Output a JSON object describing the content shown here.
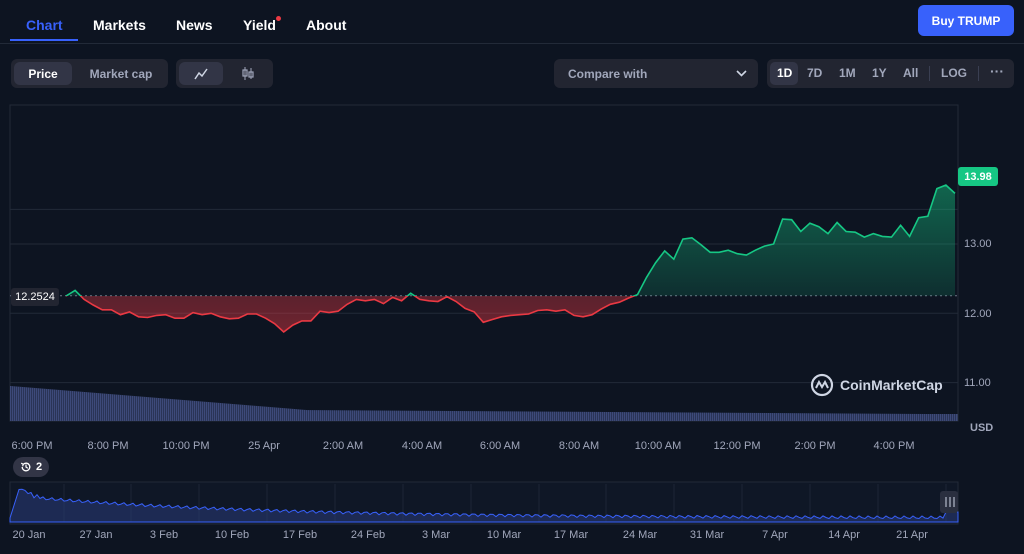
{
  "nav": {
    "tabs": [
      {
        "label": "Chart",
        "active": true
      },
      {
        "label": "Markets",
        "active": false
      },
      {
        "label": "News",
        "active": false
      },
      {
        "label": "Yield",
        "active": false,
        "badge": "red-dot"
      },
      {
        "label": "About",
        "active": false
      }
    ],
    "buy_label": "Buy TRUMP"
  },
  "toolbar": {
    "metric": [
      "Price",
      "Market cap"
    ],
    "metric_selected": "Price",
    "chart_type_icons": [
      "line-chart-icon",
      "candlestick-icon"
    ],
    "compare_placeholder": "Compare with",
    "ranges": [
      "1D",
      "7D",
      "1M",
      "1Y",
      "All",
      "LOG"
    ],
    "range_selected": "1D",
    "more_icon": "more-icon"
  },
  "chart_data": {
    "type": "line",
    "currency": "USD",
    "current_price": "13.98",
    "open_price": "12.2524",
    "y_ticks": [
      "13.00",
      "12.00",
      "11.00"
    ],
    "ylim": [
      10.9,
      14.0
    ],
    "x_ticks": [
      "6:00 PM",
      "8:00 PM",
      "10:00 PM",
      "25 Apr",
      "2:00 AM",
      "4:00 AM",
      "6:00 AM",
      "8:00 AM",
      "10:00 AM",
      "12:00 PM",
      "2:00 PM",
      "4:00 PM"
    ],
    "series": [
      {
        "values": [
          12.25,
          12.33,
          12.2,
          12.12,
          12.05,
          12.05,
          11.98,
          12.02,
          11.95,
          11.94,
          11.97,
          11.98,
          11.93,
          11.93,
          12.01,
          11.98,
          12.0,
          11.95,
          11.92,
          11.93,
          11.99,
          11.99,
          11.93,
          11.85,
          11.73,
          11.83,
          11.89,
          11.89,
          12.03,
          12.01,
          12.03,
          12.13,
          12.2,
          12.18,
          12.2,
          12.14,
          12.23,
          12.18,
          12.29,
          12.2,
          12.18,
          12.17,
          12.24,
          12.17,
          12.07,
          12.02,
          11.87,
          11.91,
          11.95,
          11.97,
          11.98,
          11.99,
          12.04,
          12.05,
          12.03,
          12.05,
          11.97,
          11.95,
          11.98,
          12.06,
          12.13,
          12.16,
          12.22,
          12.27,
          12.52,
          12.73,
          12.9,
          12.78,
          13.07,
          13.09,
          12.99,
          12.88,
          12.88,
          12.91,
          12.86,
          12.84,
          12.91,
          12.97,
          13.0,
          13.36,
          13.35,
          13.18,
          13.3,
          13.25,
          13.15,
          13.31,
          13.18,
          13.17,
          13.1,
          13.15,
          13.11,
          13.1,
          13.27,
          13.11,
          13.38,
          13.4,
          13.8,
          13.85,
          13.73
        ]
      }
    ],
    "volume_series_present": true,
    "navigator_ticks": [
      "20 Jan",
      "27 Jan",
      "3 Feb",
      "10 Feb",
      "17 Feb",
      "24 Feb",
      "3 Mar",
      "10 Mar",
      "17 Mar",
      "24 Mar",
      "31 Mar",
      "7 Apr",
      "14 Apr",
      "21 Apr"
    ],
    "history_badge": "2",
    "watermark": "CoinMarketCap",
    "colors": {
      "up": "#16c784",
      "down": "#ea3943",
      "volume": "#3d4a7a",
      "accent": "#3861fb"
    }
  }
}
